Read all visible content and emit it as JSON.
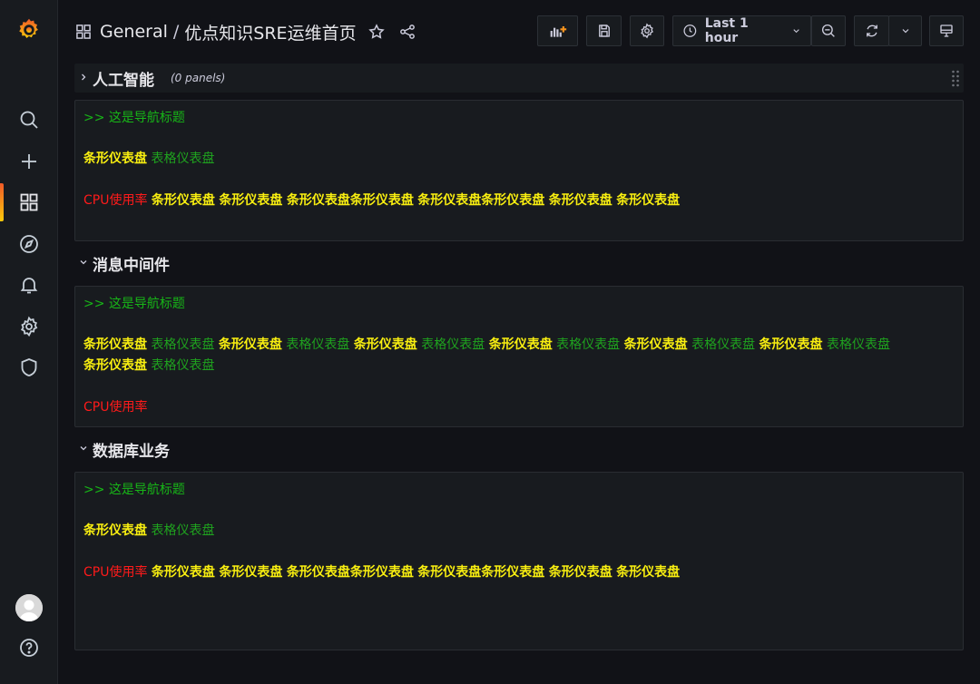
{
  "header": {
    "folder": "General",
    "separator": "/",
    "title": "优点知识SRE运维首页",
    "time_range": "Last 1 hour"
  },
  "colors": {
    "background": "#111217",
    "panel": "#181b1f",
    "nav_green": "#17b517",
    "bar_yellow": "#f8ee10",
    "table_green": "#1fa31f",
    "cpu_red": "#ff1a1a",
    "accent_orange": "#f05a28"
  },
  "sidebar": {
    "icons": [
      "grafana-logo-icon",
      "search-icon",
      "plus-icon",
      "dashboards-icon",
      "compass-icon",
      "bell-icon",
      "gear-icon",
      "shield-icon",
      "avatar",
      "help-icon"
    ]
  },
  "rows": [
    {
      "title": "人工智能",
      "count": "(0 panels)",
      "nav": ">> 这是导航标题",
      "links1": [
        "条形仪表盘",
        "表格仪表盘"
      ],
      "cpu": "CPU使用率",
      "links2": [
        "条形仪表盘",
        "条形仪表盘",
        "条形仪表盘条形仪表盘",
        "条形仪表盘条形仪表盘",
        "条形仪表盘",
        "条形仪表盘"
      ]
    },
    {
      "title": "消息中间件",
      "nav": ">> 这是导航标题",
      "links_line1": [
        "条形仪表盘",
        "表格仪表盘",
        "条形仪表盘",
        "表格仪表盘",
        "条形仪表盘",
        "表格仪表盘",
        "条形仪表盘",
        "表格仪表盘",
        "条形仪表盘",
        "表格仪表盘",
        "条形仪表盘",
        "表格仪表盘"
      ],
      "links_line2": [
        "条形仪表盘",
        "表格仪表盘"
      ],
      "cpu": "CPU使用率"
    },
    {
      "title": "数据库业务",
      "nav": ">> 这是导航标题",
      "links1": [
        "条形仪表盘",
        "表格仪表盘"
      ],
      "cpu": "CPU使用率",
      "links2": [
        "条形仪表盘",
        "条形仪表盘",
        "条形仪表盘条形仪表盘",
        "条形仪表盘条形仪表盘",
        "条形仪表盘",
        "条形仪表盘"
      ]
    }
  ]
}
